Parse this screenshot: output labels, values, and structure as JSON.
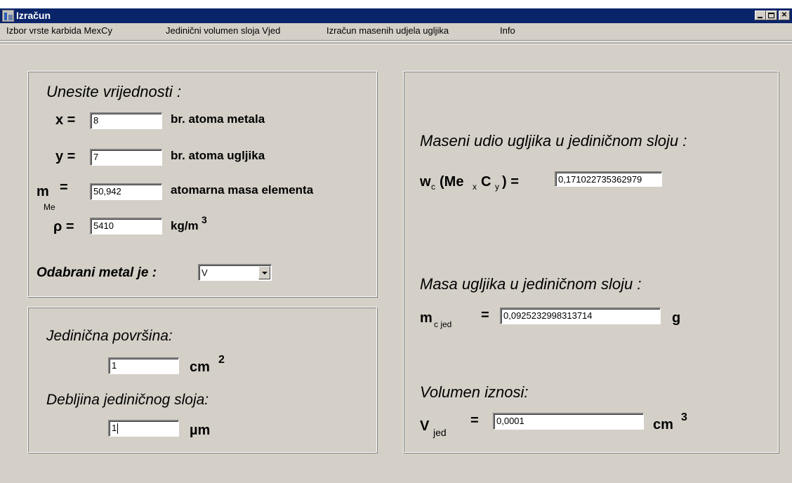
{
  "window": {
    "title": "Izračun"
  },
  "menu": {
    "items": [
      "Izbor vrste karbida MexCy",
      "Jedinični volumen sloja Vjed",
      "Izračun masenih udjela ugljika",
      "Info"
    ]
  },
  "input_panel": {
    "heading": "Unesite vrijednosti :",
    "x": {
      "symbol": "x =",
      "value": "8",
      "desc": "br. atoma metala"
    },
    "y": {
      "symbol": "y =",
      "value": "7",
      "desc": "br. atoma ugljika"
    },
    "m": {
      "symbol": "m",
      "sub": "Me",
      "eq": "=",
      "value": "50,942",
      "desc": "atomarna masa elementa"
    },
    "rho": {
      "symbol": "ρ =",
      "value": "5410",
      "unit": "kg/m",
      "unit_sup": "3"
    },
    "metal": {
      "label": "Odabrani metal je :",
      "value": "V"
    }
  },
  "unit_panel": {
    "area_label": "Jedinična površina:",
    "area_value": "1",
    "area_unit": "cm",
    "area_unit_sup": "2",
    "thickness_label": "Debljina jediničnog sloja:",
    "thickness_value": "1",
    "thickness_unit": "µm"
  },
  "results": {
    "mass_fraction_heading": "Maseni udio ugljika u jediničnom sloju :",
    "wc": {
      "w": "w",
      "c": "c",
      "me": "(Me",
      "x": "x",
      "C": "C",
      "y": "y",
      "close": ") =",
      "value": "0,171022735362979"
    },
    "carbon_mass_heading": "Masa ugljika u jediničnom sloju :",
    "mc": {
      "m": "m",
      "sub": "c jed",
      "eq": "=",
      "value": "0,0925232998313714",
      "unit": "g"
    },
    "volume_heading": "Volumen iznosi:",
    "v": {
      "V": "V",
      "sub": "jed",
      "eq": "=",
      "value": "0,0001",
      "unit": "cm",
      "unit_sup": "3"
    }
  }
}
